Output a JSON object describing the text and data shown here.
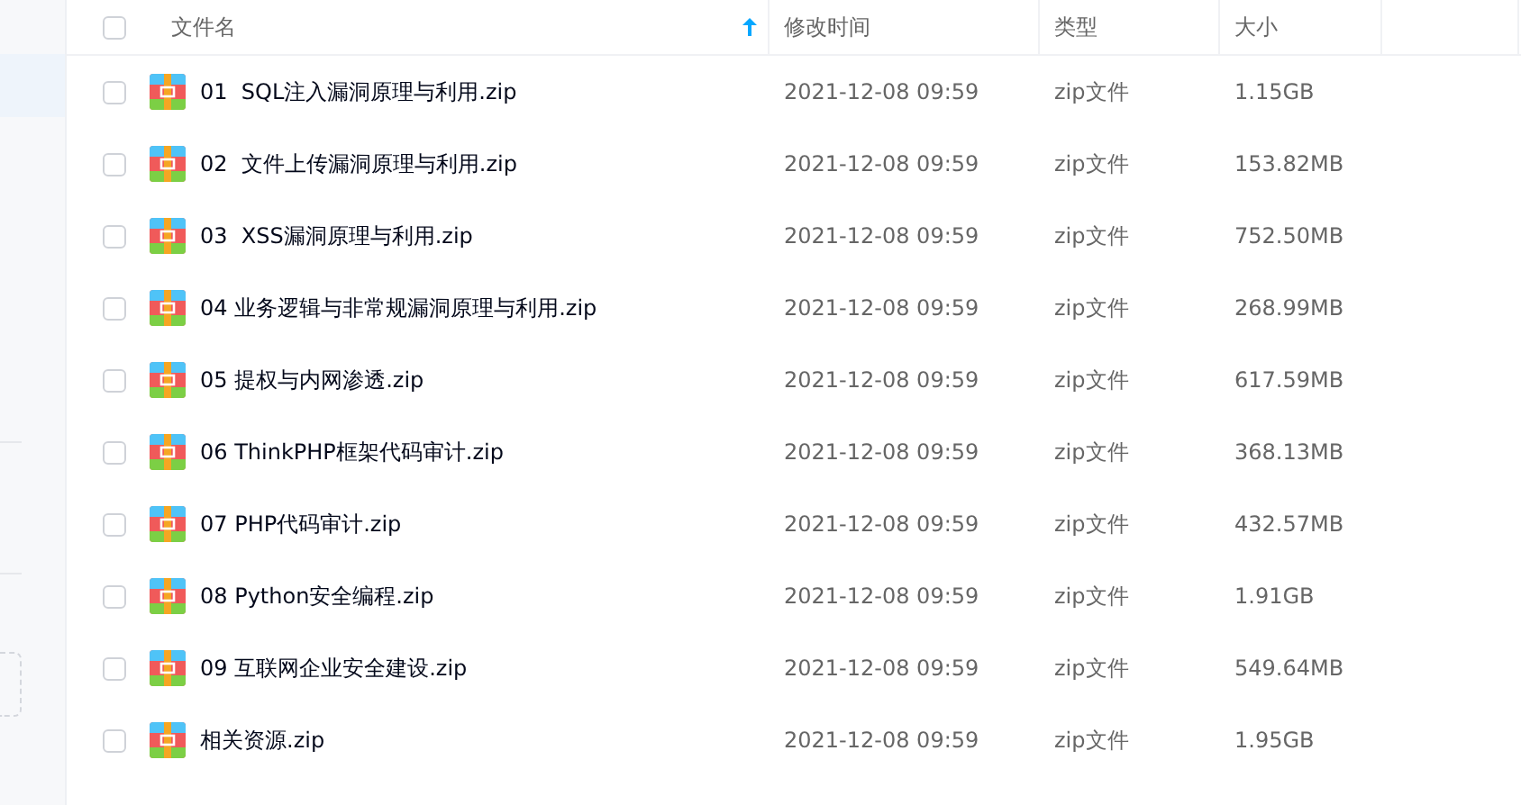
{
  "table": {
    "select_all": {
      "checked": false
    },
    "columns": [
      {
        "label": "文件名",
        "sorted": true
      },
      {
        "label": "修改时间",
        "sorted": false
      },
      {
        "label": "类型",
        "sorted": false
      },
      {
        "label": "大小",
        "sorted": false
      }
    ],
    "rows": [
      {
        "name": "01  SQL注入漏洞原理与利用.zip",
        "modified": "2021-12-08 09:59",
        "type": "zip文件",
        "size": "1.15GB",
        "checked": false
      },
      {
        "name": "02  文件上传漏洞原理与利用.zip",
        "modified": "2021-12-08 09:59",
        "type": "zip文件",
        "size": "153.82MB",
        "checked": false
      },
      {
        "name": "03  XSS漏洞原理与利用.zip",
        "modified": "2021-12-08 09:59",
        "type": "zip文件",
        "size": "752.50MB",
        "checked": false
      },
      {
        "name": "04 业务逻辑与非常规漏洞原理与利用.zip",
        "modified": "2021-12-08 09:59",
        "type": "zip文件",
        "size": "268.99MB",
        "checked": false
      },
      {
        "name": "05 提权与内网渗透.zip",
        "modified": "2021-12-08 09:59",
        "type": "zip文件",
        "size": "617.59MB",
        "checked": false
      },
      {
        "name": "06 ThinkPHP框架代码审计.zip",
        "modified": "2021-12-08 09:59",
        "type": "zip文件",
        "size": "368.13MB",
        "checked": false
      },
      {
        "name": "07 PHP代码审计.zip",
        "modified": "2021-12-08 09:59",
        "type": "zip文件",
        "size": "432.57MB",
        "checked": false
      },
      {
        "name": "08 Python安全编程.zip",
        "modified": "2021-12-08 09:59",
        "type": "zip文件",
        "size": "1.91GB",
        "checked": false
      },
      {
        "name": "09 互联网企业安全建设.zip",
        "modified": "2021-12-08 09:59",
        "type": "zip文件",
        "size": "549.64MB",
        "checked": false
      },
      {
        "name": "相关资源.zip",
        "modified": "2021-12-08 09:59",
        "type": "zip文件",
        "size": "1.95GB",
        "checked": false
      }
    ]
  }
}
